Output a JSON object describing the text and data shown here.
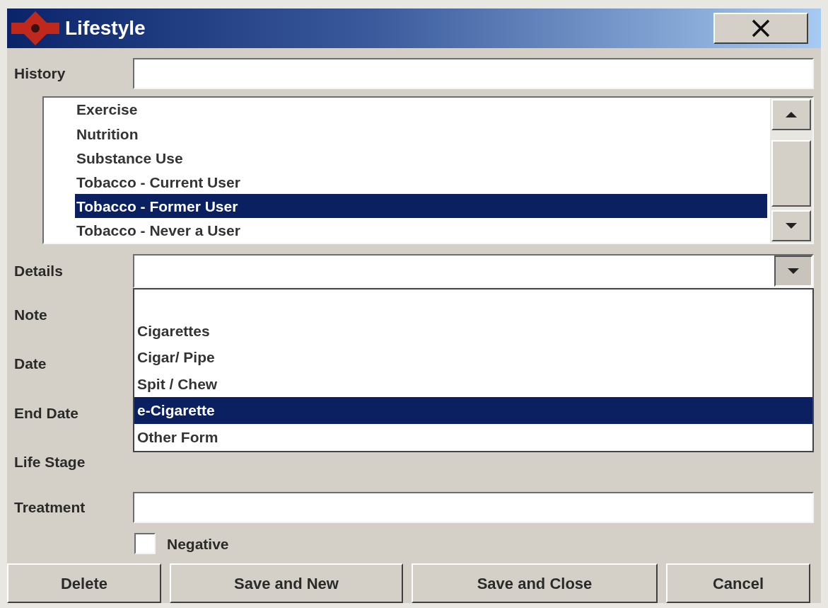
{
  "window": {
    "title": "Lifestyle"
  },
  "history": {
    "label": "History"
  },
  "history_list": {
    "items": [
      {
        "label": "Exercise",
        "selected": false
      },
      {
        "label": "Nutrition",
        "selected": false
      },
      {
        "label": "Substance Use",
        "selected": false
      },
      {
        "label": "Tobacco - Current User",
        "selected": false
      },
      {
        "label": "Tobacco - Former User",
        "selected": true
      },
      {
        "label": "Tobacco - Never a User",
        "selected": false
      }
    ]
  },
  "details": {
    "label": "Details",
    "open": true,
    "options": [
      {
        "label": "Cigarettes",
        "selected": false
      },
      {
        "label": "Cigar/ Pipe",
        "selected": false
      },
      {
        "label": "Spit / Chew",
        "selected": false
      },
      {
        "label": "e-Cigarette",
        "selected": true
      },
      {
        "label": "Other Form",
        "selected": false
      }
    ]
  },
  "covered_fields": [
    {
      "label": "Note"
    },
    {
      "label": "Date"
    },
    {
      "label": "End Date"
    },
    {
      "label": "Life Stage"
    }
  ],
  "treatment": {
    "label": "Treatment"
  },
  "negative": {
    "label": "Negative",
    "checked": false
  },
  "buttons": [
    "Delete",
    "Save and New",
    "Save and Close",
    "Cancel"
  ]
}
